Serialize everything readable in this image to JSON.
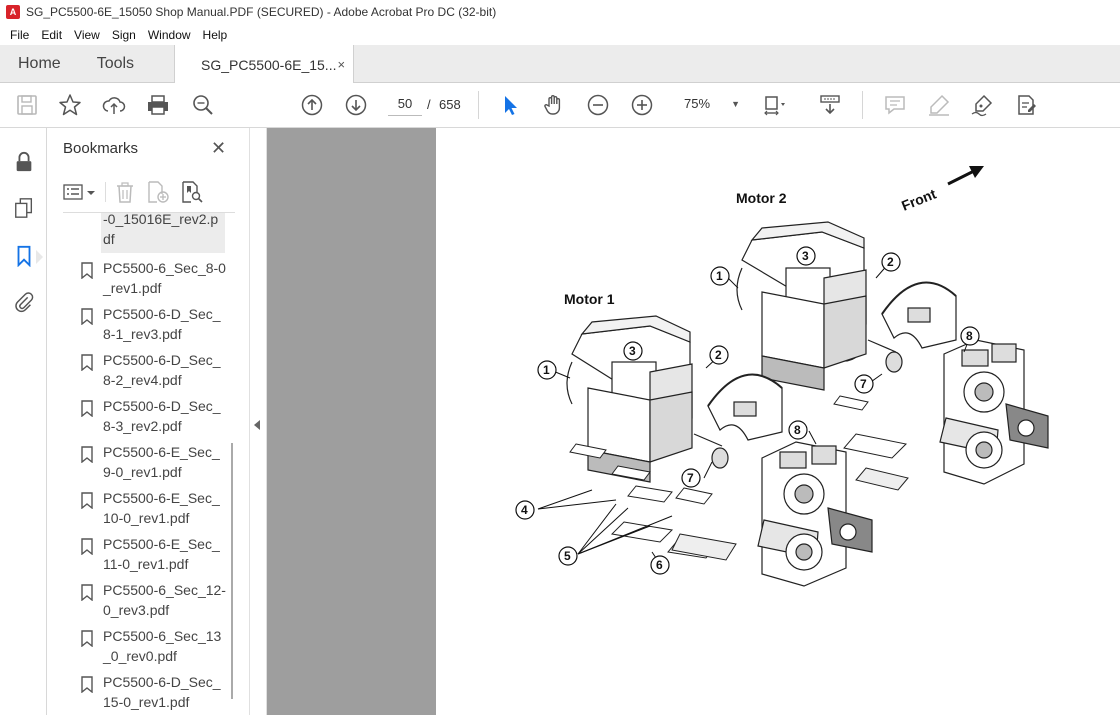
{
  "window": {
    "title": "SG_PC5500-6E_15050 Shop Manual.PDF (SECURED) - Adobe Acrobat Pro DC (32-bit)"
  },
  "menu": {
    "items": [
      "File",
      "Edit",
      "View",
      "Sign",
      "Window",
      "Help"
    ]
  },
  "tabs": {
    "home": "Home",
    "tools": "Tools",
    "doc": "SG_PC5500-6E_15...",
    "close": "×"
  },
  "toolbar": {
    "page_current": "50",
    "page_sep": "/",
    "page_total": "658",
    "zoom": "75%"
  },
  "bookmarks": {
    "title": "Bookmarks",
    "close": "✕",
    "partial_item": "-0_15016E_rev2.pdf",
    "items": [
      "PC5500-6_Sec_8-0_rev1.pdf",
      "PC5500-6-D_Sec_8-1_rev3.pdf",
      "PC5500-6-D_Sec_8-2_rev4.pdf",
      "PC5500-6-D_Sec_8-3_rev2.pdf",
      "PC5500-6-E_Sec_9-0_rev1.pdf",
      "PC5500-6-E_Sec_10-0_rev1.pdf",
      "PC5500-6-E_Sec_11-0_rev1.pdf",
      "PC5500-6_Sec_12-0_rev3.pdf",
      "PC5500-6_Sec_13_0_rev0.pdf",
      "PC5500-6-D_Sec_15-0_rev1.pdf"
    ]
  },
  "figure": {
    "motor1": "Motor 1",
    "motor2": "Motor 2",
    "front": "Front",
    "callouts": [
      "1",
      "2",
      "3",
      "4",
      "5",
      "6",
      "7",
      "8"
    ]
  },
  "colors": {
    "accent": "#1473e6",
    "doc_bg": "#9e9e9e",
    "acrobat_red": "#d8232a"
  }
}
